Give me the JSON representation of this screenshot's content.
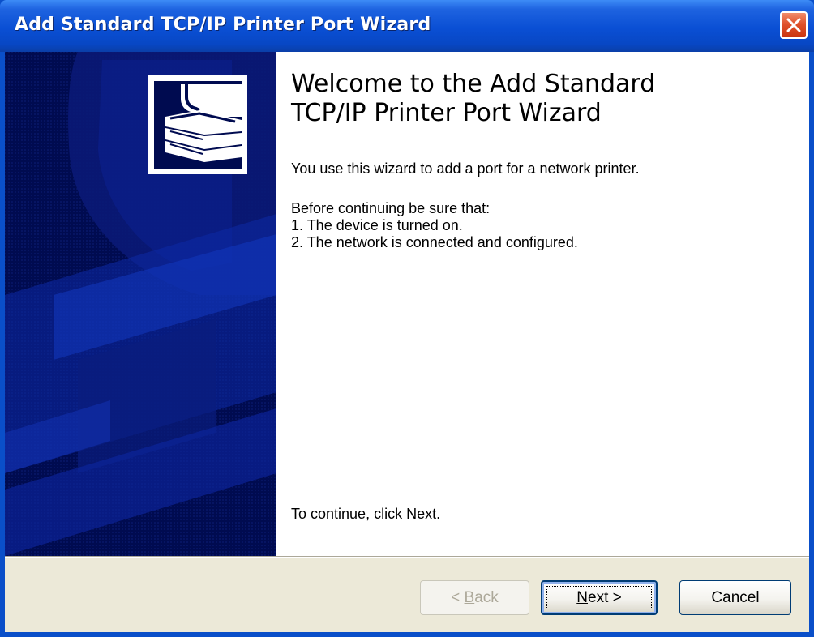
{
  "window": {
    "title": "Add Standard TCP/IP Printer Port Wizard",
    "close_icon": "close-icon"
  },
  "welcome": {
    "heading": "Welcome to the Add Standard\nTCP/IP Printer Port Wizard",
    "intro": "You use this wizard to add a port for a network printer.",
    "before_label": "Before continuing be sure that:",
    "requirements": [
      "1.  The device is turned on.",
      "2.  The network is connected and configured."
    ],
    "continue_hint": "To continue, click Next."
  },
  "buttons": {
    "back": {
      "prefix": "< ",
      "mnemonic": "B",
      "rest": "ack",
      "enabled": false
    },
    "next": {
      "prefix": "",
      "mnemonic": "N",
      "rest": "ext >",
      "enabled": true,
      "default": true
    },
    "cancel": {
      "label": "Cancel",
      "enabled": true
    }
  },
  "icons": {
    "wizard_graphic": "printer-graphic-icon",
    "side_art": "printer-watermark"
  },
  "colors": {
    "title_bar": "#0a4fd4",
    "side_panel": "#000b50",
    "footer": "#ece9d8",
    "close_button": "#e0522c"
  }
}
